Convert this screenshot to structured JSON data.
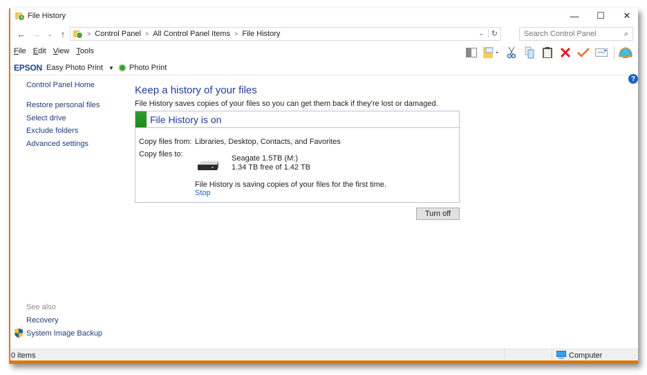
{
  "window": {
    "title": "File History",
    "controls": {
      "minimize": "—",
      "maximize": "☐",
      "close": "✕"
    }
  },
  "nav": {
    "back": "←",
    "forward": "→",
    "recent": "⌄",
    "up": "↑",
    "breadcrumb": [
      "Control Panel",
      "All Control Panel Items",
      "File History"
    ],
    "dropdown": "⌄",
    "refresh": "↻",
    "search_placeholder": "Search Control Panel",
    "search_icon": "⌕"
  },
  "menu": {
    "items": [
      {
        "label": "File",
        "accel": "F",
        "rest": "ile"
      },
      {
        "label": "Edit",
        "accel": "E",
        "rest": "dit"
      },
      {
        "label": "View",
        "accel": "V",
        "rest": "iew"
      },
      {
        "label": "Tools",
        "accel": "T",
        "rest": "ools"
      }
    ]
  },
  "toolbar": {
    "icons": [
      "layout-pane-icon",
      "folder-properties-icon",
      "cut-icon",
      "copy-icon",
      "paste-icon",
      "delete-icon",
      "check-icon",
      "email-icon",
      "shell-icon"
    ]
  },
  "epson": {
    "logo": "EPSON",
    "easy_photo_print": "Easy Photo Print",
    "dropdown": "▼",
    "photo_print": "Photo Print"
  },
  "help": {
    "label": "?"
  },
  "sidebar": {
    "home": "Control Panel Home",
    "links": [
      "Restore personal files",
      "Select drive",
      "Exclude folders",
      "Advanced settings"
    ],
    "see_also": "See also",
    "see_also_links": [
      "Recovery",
      "System Image Backup"
    ]
  },
  "main": {
    "title": "Keep a history of your files",
    "description": "File History saves copies of your files so you can get them back if they're lost or damaged.",
    "status": {
      "title": "File History is on",
      "color": "#2e9c2e",
      "copy_from_label": "Copy files from:",
      "copy_from_value": "Libraries, Desktop, Contacts, and Favorites",
      "copy_to_label": "Copy files to:",
      "drive_name": "Seagate 1.5TB (M:)",
      "drive_free": "1.34 TB free of 1.42 TB",
      "saving_message": "File History is saving copies of your files for the first time.",
      "stop_link": "Stop"
    },
    "turn_off_button": "Turn off"
  },
  "statusbar": {
    "items": "0 items",
    "location": "Computer"
  },
  "colors": {
    "accent_orange": "#de7711",
    "link_blue": "#1a62c2",
    "heading_blue": "#1e3c9a",
    "status_green": "#2e9c2e"
  }
}
